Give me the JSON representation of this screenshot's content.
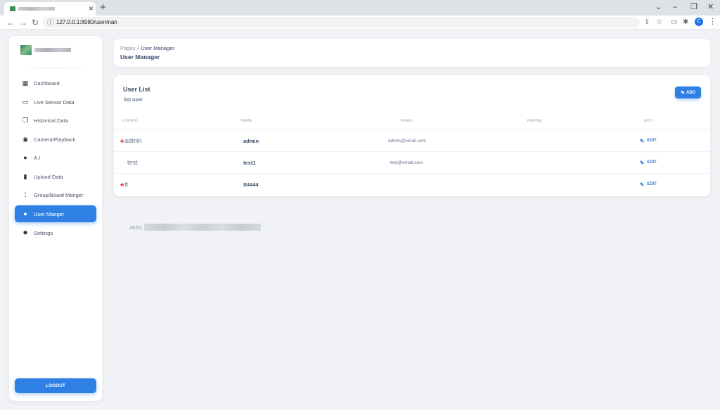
{
  "browser": {
    "tab_close": "×",
    "new_tab": "+",
    "url": "127.0.0.1:8080/userman",
    "profile_initial": "C",
    "window_controls": [
      "⌄",
      "–",
      "❐",
      "✕"
    ],
    "nav": {
      "back": "←",
      "forward": "→",
      "reload": "↻",
      "info": "ⓘ"
    },
    "extensions": [
      "⇪",
      "☆",
      "▭",
      "✱"
    ],
    "menu": "⋮"
  },
  "sidebar": {
    "items": [
      {
        "label": "Dashboard",
        "icon": "dashboard-icon",
        "glyph": "▦",
        "active": false
      },
      {
        "label": "Live Sensor Data",
        "icon": "cast-icon",
        "glyph": "▭",
        "active": false
      },
      {
        "label": "Historical Data",
        "icon": "library-icon",
        "glyph": "❐",
        "active": false
      },
      {
        "label": "Camera/Playback",
        "icon": "play-circle-icon",
        "glyph": "◉",
        "active": false
      },
      {
        "label": "A.I",
        "icon": "location-pin-icon",
        "glyph": "●",
        "active": false
      },
      {
        "label": "Upload Data",
        "icon": "upload-file-icon",
        "glyph": "▮",
        "active": false
      },
      {
        "label": "Group/Board Manger",
        "icon": "graphic-eq-icon",
        "glyph": "⁞",
        "active": false
      },
      {
        "label": "User Manger",
        "icon": "person-icon",
        "glyph": "●",
        "active": true
      },
      {
        "label": "Settings",
        "icon": "gear-icon",
        "glyph": "✹",
        "active": false
      }
    ],
    "logout_label": "LOGOUT"
  },
  "header": {
    "breadcrumb_parent": "Pages",
    "breadcrumb_sep": "/",
    "breadcrumb_current": "User Manager",
    "title": "User Manager"
  },
  "user_list": {
    "title": "User List",
    "subtitle": "list user",
    "add_label": "ADD",
    "columns": [
      "USERID",
      "NAME",
      "EMAIL",
      "PHONE",
      "EDIT"
    ],
    "rows": [
      {
        "userid": "admin",
        "admin_icon": true,
        "name": "admin",
        "email": "admin@email.com",
        "phone": "",
        "edit": "EDIT"
      },
      {
        "userid": "test",
        "admin_icon": false,
        "name": "test1",
        "email": "test@email.com",
        "phone": "",
        "edit": "EDIT"
      },
      {
        "userid": "tt",
        "admin_icon": true,
        "name": "tt4444",
        "email": "",
        "phone": "",
        "edit": "EDIT"
      }
    ]
  },
  "footer": {
    "text": "2022,"
  },
  "colors": {
    "accent": "#2f80e4",
    "admin_icon": "#e53935",
    "background": "#f0f2f5"
  }
}
